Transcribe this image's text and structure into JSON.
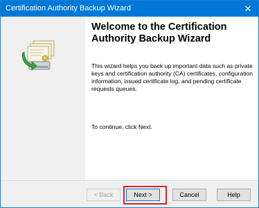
{
  "window": {
    "title": "Certification Authority Backup Wizard",
    "close_glyph": "✕"
  },
  "wizard": {
    "icon": "certificate-backup-icon",
    "heading": "Welcome to the Certification Authority Backup Wizard",
    "description": "This wizard helps you back up important data such as private keys and certification authority (CA) certificates, configuration information, issued certificate log, and pending certificate requests queues.",
    "continue_text": "To continue, click Next."
  },
  "buttons": {
    "back": "< Back",
    "next": "Next >",
    "cancel": "Cancel",
    "help": "Help",
    "back_enabled": false
  },
  "colors": {
    "titlebar": "#0078d7",
    "highlight": "#e0202c"
  }
}
